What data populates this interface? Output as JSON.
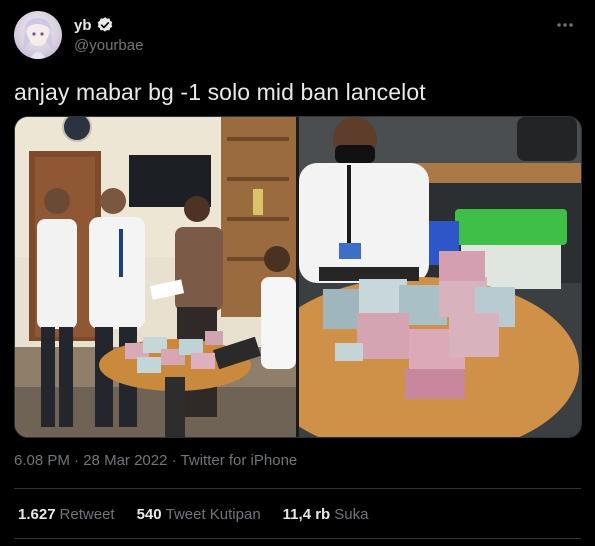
{
  "tweet": {
    "display_name": "yb",
    "handle": "@yourbae",
    "verified": true,
    "text": "anjay mabar bg -1 solo mid ban lancelot",
    "time": "6.08 PM",
    "date": "28 Mar 2022",
    "separator": "·",
    "source": "Twitter for iPhone"
  },
  "stats": {
    "retweets_count": "1.627",
    "retweets_label": "Retweet",
    "quotes_count": "540",
    "quotes_label": "Tweet Kutipan",
    "likes_count": "11,4 rb",
    "likes_label": "Suka"
  },
  "colors": {
    "background": "#000000",
    "text_primary": "#e7e9ea",
    "text_secondary": "#71767b",
    "divider": "#2f3336",
    "verified": "#e7e9ea"
  },
  "icons": {
    "verified": "verified-badge-icon",
    "more": "more-dots-icon"
  }
}
